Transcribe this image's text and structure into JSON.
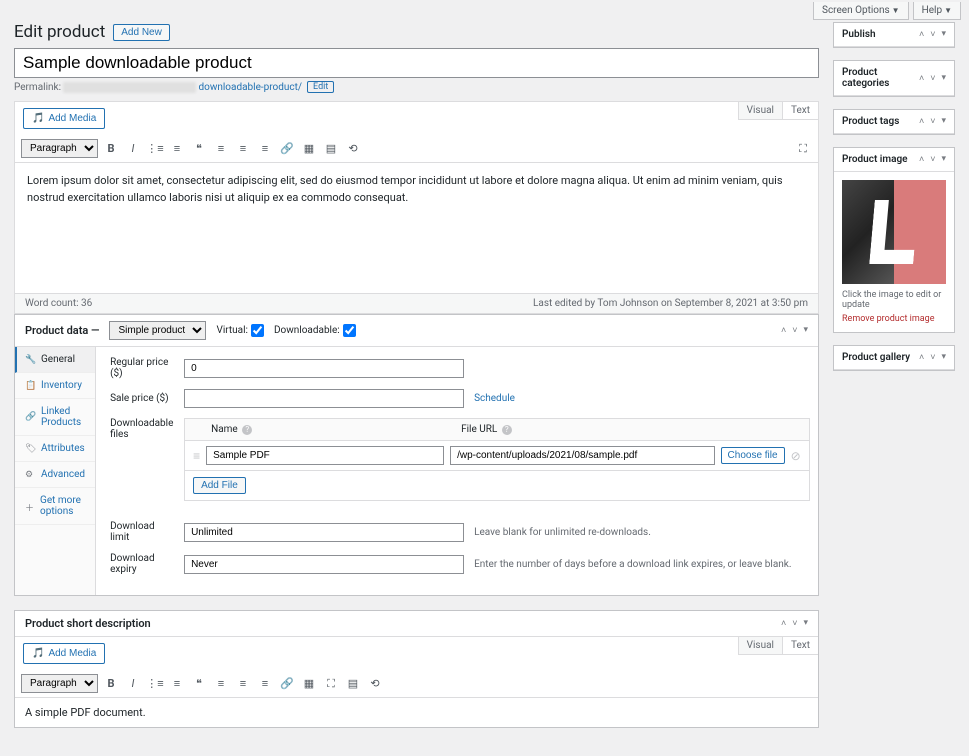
{
  "topbar": {
    "screen_options": "Screen Options",
    "help": "Help"
  },
  "header": {
    "title": "Edit product",
    "add_new": "Add New"
  },
  "title_field": {
    "value": "Sample downloadable product"
  },
  "permalink": {
    "label": "Permalink:",
    "prefix": "",
    "suffix": "downloadable-product/",
    "edit": "Edit"
  },
  "editor": {
    "add_media": "Add Media",
    "visual_tab": "Visual",
    "text_tab": "Text",
    "paragraph_select": "Paragraph",
    "content": "Lorem ipsum dolor sit amet, consectetur adipiscing elit, sed do eiusmod tempor incididunt ut labore et dolore magna aliqua. Ut enim ad minim veniam, quis nostrud exercitation ullamco laboris nisi ut aliquip ex ea commodo consequat.",
    "word_count_label": "Word count:",
    "word_count": "36",
    "last_edited": "Last edited by Tom Johnson on September 8, 2021 at 3:50 pm"
  },
  "product_data": {
    "heading": "Product data",
    "type_select": "Simple product",
    "virtual_label": "Virtual:",
    "downloadable_label": "Downloadable:",
    "tabs": {
      "general": "General",
      "inventory": "Inventory",
      "linked": "Linked Products",
      "attributes": "Attributes",
      "advanced": "Advanced",
      "more": "Get more options"
    },
    "fields": {
      "regular_price_label": "Regular price ($)",
      "regular_price_value": "0",
      "sale_price_label": "Sale price ($)",
      "sale_price_value": "",
      "schedule_link": "Schedule",
      "downloadable_files_label": "Downloadable files",
      "col_name": "Name",
      "col_url": "File URL",
      "file_name_value": "Sample PDF",
      "file_url_value": "/wp-content/uploads/2021/08/sample.pdf",
      "choose_file": "Choose file",
      "add_file": "Add File",
      "download_limit_label": "Download limit",
      "download_limit_value": "Unlimited",
      "download_limit_note": "Leave blank for unlimited re-downloads.",
      "download_expiry_label": "Download expiry",
      "download_expiry_value": "Never",
      "download_expiry_note": "Enter the number of days before a download link expires, or leave blank."
    }
  },
  "short_desc": {
    "heading": "Product short description",
    "add_media": "Add Media",
    "paragraph_select": "Paragraph",
    "content": "A simple PDF document."
  },
  "sidebar": {
    "publish": {
      "title": "Publish"
    },
    "categories": {
      "title": "Product categories"
    },
    "tags": {
      "title": "Product tags"
    },
    "image": {
      "title": "Product image",
      "caption": "Click the image to edit or update",
      "remove": "Remove product image"
    },
    "gallery": {
      "title": "Product gallery"
    }
  }
}
